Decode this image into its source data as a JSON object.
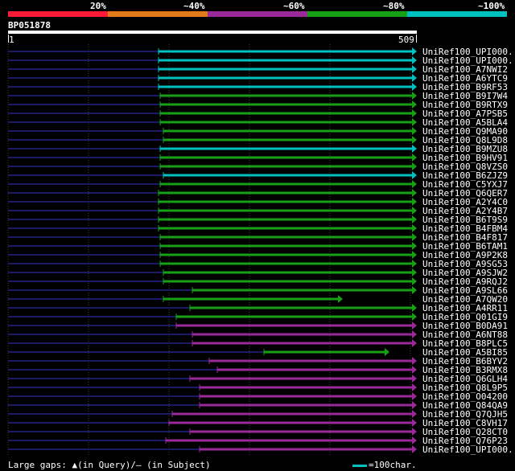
{
  "identity_scale": {
    "ticks": [
      "20%",
      "~40%",
      "~60%",
      "~80%",
      "~100%"
    ],
    "colors": [
      "#ff1a3a",
      "#e07a1a",
      "#9a2a9a",
      "#16a016",
      "#00c0c0"
    ]
  },
  "query": {
    "id": "BP051878",
    "start": "1",
    "end": "509"
  },
  "hits": [
    {
      "label": "UniRef100_UPI000..",
      "color": "#00c0c0"
    },
    {
      "label": "UniRef100_UPI000..",
      "color": "#00c0c0"
    },
    {
      "label": "UniRef100_A7NWI2",
      "color": "#00c0c0"
    },
    {
      "label": "UniRef100_A6YTC9",
      "color": "#00c0c0"
    },
    {
      "label": "UniRef100_B9RF53",
      "color": "#00c0c0"
    },
    {
      "label": "UniRef100_B9I7W4",
      "color": "#16a016"
    },
    {
      "label": "UniRef100_B9RTX9",
      "color": "#16a016"
    },
    {
      "label": "UniRef100_A7PSB5",
      "color": "#16a016"
    },
    {
      "label": "UniRef100_A5BLA4",
      "color": "#16a016"
    },
    {
      "label": "UniRef100_Q9MA90",
      "color": "#16a016"
    },
    {
      "label": "UniRef100_Q8L9D8",
      "color": "#16a016"
    },
    {
      "label": "UniRef100_B9MZU8",
      "color": "#00c0c0"
    },
    {
      "label": "UniRef100_B9HV91",
      "color": "#16a016"
    },
    {
      "label": "UniRef100_Q8VZS0",
      "color": "#16a016"
    },
    {
      "label": "UniRef100_B6ZJZ9",
      "color": "#00c0c0"
    },
    {
      "label": "UniRef100_C5YXJ7",
      "color": "#16a016"
    },
    {
      "label": "UniRef100_Q6QER7",
      "color": "#16a016"
    },
    {
      "label": "UniRef100_A2Y4C0",
      "color": "#16a016"
    },
    {
      "label": "UniRef100_A2Y4B7",
      "color": "#16a016"
    },
    {
      "label": "UniRef100_B6T9S9",
      "color": "#16a016"
    },
    {
      "label": "UniRef100_B4FBM4",
      "color": "#16a016"
    },
    {
      "label": "UniRef100_B4F817",
      "color": "#16a016"
    },
    {
      "label": "UniRef100_B6TAM1",
      "color": "#16a016"
    },
    {
      "label": "UniRef100_A9P2K8",
      "color": "#16a016"
    },
    {
      "label": "UniRef100_A9SG53",
      "color": "#16a016"
    },
    {
      "label": "UniRef100_A9SJW2",
      "color": "#16a016"
    },
    {
      "label": "UniRef100_A9RQJ2",
      "color": "#16a016"
    },
    {
      "label": "UniRef100_A9SL66",
      "color": "#16a016"
    },
    {
      "label": "UniRef100_A7QW20",
      "color": "#16a016"
    },
    {
      "label": "UniRef100_A4RR11",
      "color": "#16a016"
    },
    {
      "label": "UniRef100_Q01GI9",
      "color": "#16a016"
    },
    {
      "label": "UniRef100_B0DA91",
      "color": "#9a2a9a"
    },
    {
      "label": "UniRef100_A6NT88",
      "color": "#9a2a9a"
    },
    {
      "label": "UniRef100_B8PLC5",
      "color": "#9a2a9a"
    },
    {
      "label": "UniRef100_A5BI85",
      "color": "#16a016"
    },
    {
      "label": "UniRef100_B6BYV2",
      "color": "#9a2a9a"
    },
    {
      "label": "UniRef100_B3RMX8",
      "color": "#9a2a9a"
    },
    {
      "label": "UniRef100_Q6GLH4",
      "color": "#9a2a9a"
    },
    {
      "label": "UniRef100_Q8L9P5",
      "color": "#9a2a9a"
    },
    {
      "label": "UniRef100_O04200",
      "color": "#9a2a9a"
    },
    {
      "label": "UniRef100_Q84QA9",
      "color": "#9a2a9a"
    },
    {
      "label": "UniRef100_Q7QJH5",
      "color": "#9a2a9a"
    },
    {
      "label": "UniRef100_C8VH17",
      "color": "#9a2a9a"
    },
    {
      "label": "UniRef100_Q28CT0",
      "color": "#9a2a9a"
    },
    {
      "label": "UniRef100_Q76P23",
      "color": "#9a2a9a"
    },
    {
      "label": "UniRef100_UPI000..",
      "color": "#9a2a9a"
    }
  ],
  "footer": {
    "legend": "Large gaps: ▲(in Query)/– (in Subject)",
    "scale": "=100char."
  }
}
